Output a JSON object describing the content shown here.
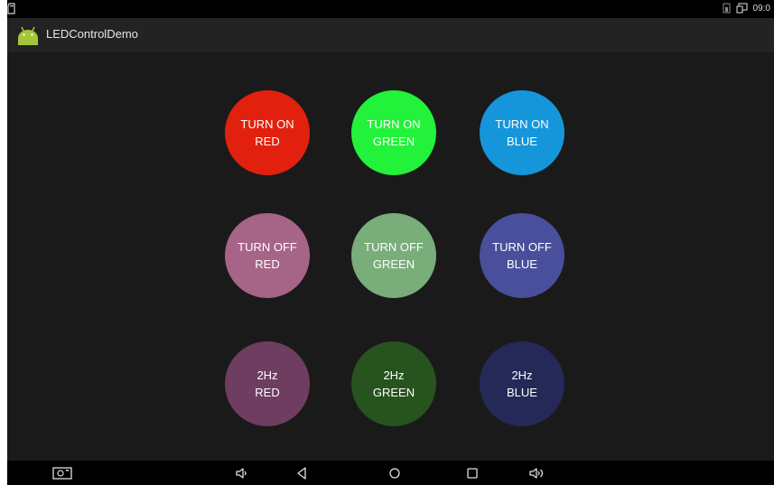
{
  "status_bar": {
    "time": "09:0"
  },
  "app": {
    "title": "LEDControlDemo"
  },
  "buttons": [
    {
      "line1": "TURN ON",
      "line2": "RED",
      "color": "#e1210e"
    },
    {
      "line1": "TURN ON",
      "line2": "GREEN",
      "color": "#22f23a"
    },
    {
      "line1": "TURN ON",
      "line2": "BLUE",
      "color": "#1596db"
    },
    {
      "line1": "TURN OFF",
      "line2": "RED",
      "color": "#a66487"
    },
    {
      "line1": "TURN OFF",
      "line2": "GREEN",
      "color": "#79ad7a"
    },
    {
      "line1": "TURN OFF",
      "line2": "BLUE",
      "color": "#4a4f9b"
    },
    {
      "line1": "2Hz",
      "line2": "RED",
      "color": "#6e3d60"
    },
    {
      "line1": "2Hz",
      "line2": "GREEN",
      "color": "#27531e"
    },
    {
      "line1": "2Hz",
      "line2": "BLUE",
      "color": "#252958"
    }
  ],
  "nav_bar": {
    "icons": [
      "screenshot-icon",
      "volume-down-icon",
      "back-icon",
      "home-icon",
      "recents-icon",
      "volume-up-icon"
    ]
  }
}
